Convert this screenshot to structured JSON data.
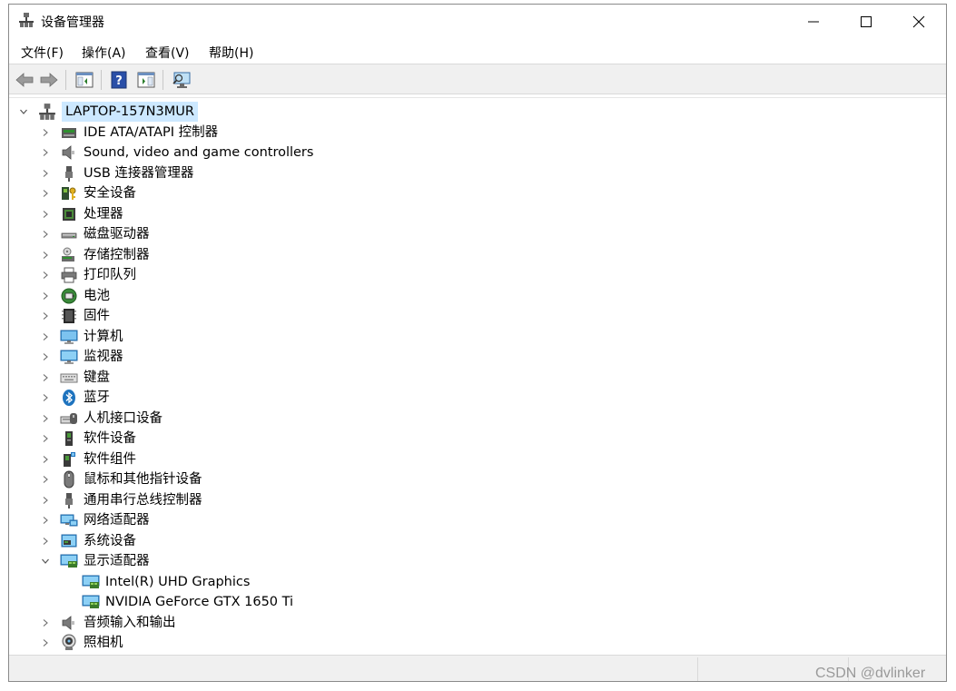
{
  "window": {
    "title": "设备管理器"
  },
  "menu": {
    "file": "文件(F)",
    "action": "操作(A)",
    "view": "查看(V)",
    "help": "帮助(H)"
  },
  "tree": {
    "root": "LAPTOP-157N3MUR",
    "items": [
      {
        "label": "IDE ATA/ATAPI 控制器",
        "icon": "ide-controller-icon",
        "expanded": false
      },
      {
        "label": "Sound, video and game controllers",
        "icon": "speaker-icon",
        "expanded": false
      },
      {
        "label": "USB 连接器管理器",
        "icon": "usb-plug-icon",
        "expanded": false
      },
      {
        "label": "安全设备",
        "icon": "security-key-icon",
        "expanded": false
      },
      {
        "label": "处理器",
        "icon": "cpu-icon",
        "expanded": false
      },
      {
        "label": "磁盘驱动器",
        "icon": "disk-drive-icon",
        "expanded": false
      },
      {
        "label": "存储控制器",
        "icon": "storage-controller-icon",
        "expanded": false
      },
      {
        "label": "打印队列",
        "icon": "printer-icon",
        "expanded": false
      },
      {
        "label": "电池",
        "icon": "battery-icon",
        "expanded": false
      },
      {
        "label": "固件",
        "icon": "firmware-chip-icon",
        "expanded": false
      },
      {
        "label": "计算机",
        "icon": "computer-icon",
        "expanded": false
      },
      {
        "label": "监视器",
        "icon": "monitor-icon",
        "expanded": false
      },
      {
        "label": "键盘",
        "icon": "keyboard-icon",
        "expanded": false
      },
      {
        "label": "蓝牙",
        "icon": "bluetooth-icon",
        "expanded": false
      },
      {
        "label": "人机接口设备",
        "icon": "hid-icon",
        "expanded": false
      },
      {
        "label": "软件设备",
        "icon": "software-device-icon",
        "expanded": false
      },
      {
        "label": "软件组件",
        "icon": "software-component-icon",
        "expanded": false
      },
      {
        "label": "鼠标和其他指针设备",
        "icon": "mouse-icon",
        "expanded": false
      },
      {
        "label": "通用串行总线控制器",
        "icon": "usb-controller-icon",
        "expanded": false
      },
      {
        "label": "网络适配器",
        "icon": "network-adapter-icon",
        "expanded": false
      },
      {
        "label": "系统设备",
        "icon": "system-device-icon",
        "expanded": false
      },
      {
        "label": "显示适配器",
        "icon": "display-adapter-icon",
        "expanded": true,
        "children": [
          {
            "label": "Intel(R) UHD Graphics",
            "icon": "display-adapter-icon"
          },
          {
            "label": "NVIDIA GeForce GTX 1650 Ti",
            "icon": "display-adapter-icon"
          }
        ]
      },
      {
        "label": "音频输入和输出",
        "icon": "audio-icon",
        "expanded": false
      },
      {
        "label": "照相机",
        "icon": "camera-icon",
        "expanded": false
      }
    ]
  },
  "watermark": "CSDN @dvlinker",
  "colors": {
    "selection": "#cce8ff",
    "toolbar": "#f0f0f0",
    "accent": "#1e73be"
  }
}
